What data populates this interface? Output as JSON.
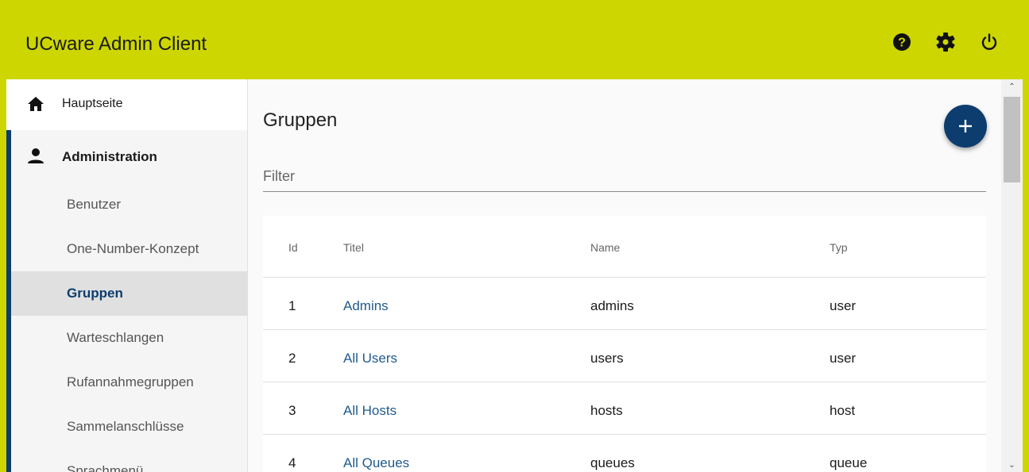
{
  "header": {
    "title": "UCware Admin Client",
    "icons": [
      "help-icon",
      "settings-gear-icon",
      "power-icon"
    ],
    "bg_color": "#cdd600"
  },
  "sidebar": {
    "home_label": "Hauptseite",
    "admin_label": "Administration",
    "items": [
      {
        "label": "Benutzer"
      },
      {
        "label": "One-Number-Konzept"
      },
      {
        "label": "Gruppen",
        "active": true
      },
      {
        "label": "Warteschlangen"
      },
      {
        "label": "Rufannahmegruppen"
      },
      {
        "label": "Sammelanschlüsse"
      },
      {
        "label": "Sprachmenü"
      }
    ],
    "accent_color": "#0d3d6e"
  },
  "main": {
    "page_title": "Gruppen",
    "filter_placeholder": "Filter",
    "add_button": "+",
    "table": {
      "columns": [
        "Id",
        "Titel",
        "Name",
        "Typ"
      ],
      "rows": [
        {
          "id": "1",
          "titel": "Admins",
          "name": "admins",
          "typ": "user"
        },
        {
          "id": "2",
          "titel": "All Users",
          "name": "users",
          "typ": "user"
        },
        {
          "id": "3",
          "titel": "All Hosts",
          "name": "hosts",
          "typ": "host"
        },
        {
          "id": "4",
          "titel": "All Queues",
          "name": "queues",
          "typ": "queue"
        }
      ]
    }
  }
}
